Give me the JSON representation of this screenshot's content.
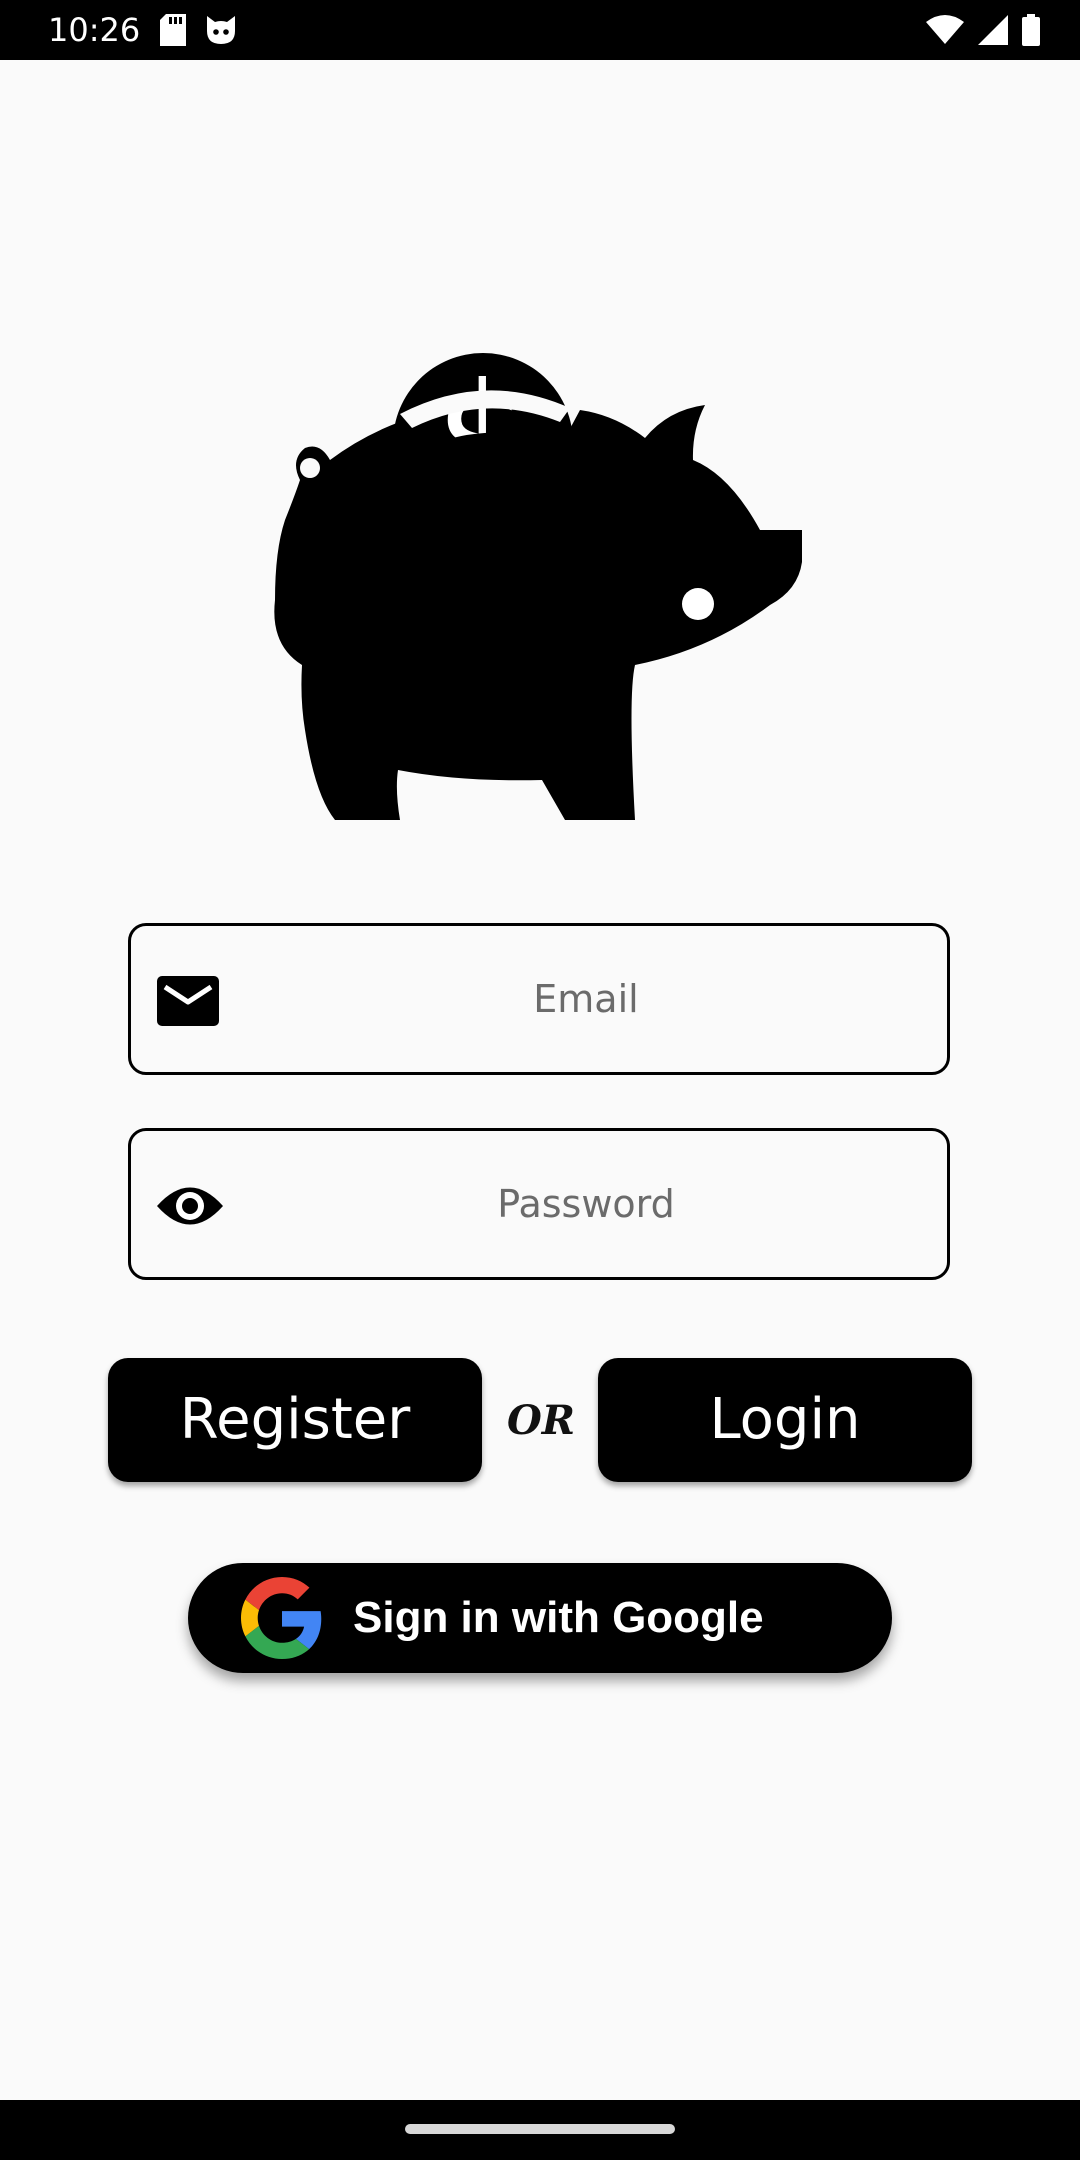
{
  "status_bar": {
    "time": "10:26",
    "left_icons": [
      "sd-card-icon",
      "cat-face-icon"
    ],
    "right_icons": [
      "wifi-icon",
      "cell-signal-icon",
      "battery-icon"
    ]
  },
  "logo": {
    "icon": "piggy-bank-dollar-icon"
  },
  "email_field": {
    "placeholder": "Email",
    "value": "",
    "icon": "envelope-icon"
  },
  "password_field": {
    "placeholder": "Password",
    "value": "",
    "icon": "eye-icon"
  },
  "actions": {
    "register_label": "Register",
    "or_label": "OR",
    "login_label": "Login"
  },
  "google": {
    "label": "Sign in with Google",
    "icon": "google-g-icon"
  },
  "colors": {
    "background": "#fafafa",
    "button": "#000000",
    "button_text": "#ffffff",
    "google_red": "#EA4335",
    "google_yellow": "#FBBC05",
    "google_green": "#34A853",
    "google_blue": "#4285F4"
  }
}
